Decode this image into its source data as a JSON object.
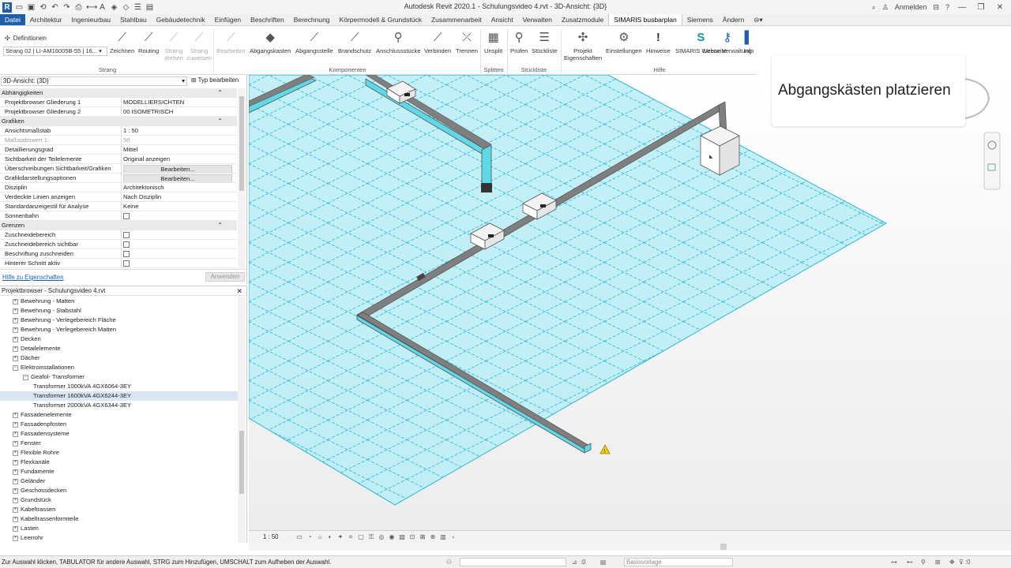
{
  "app": {
    "title": "Autodesk Revit 2020.1 - Schulungsvideo 4.rvt - 3D-Ansicht: {3D}",
    "user": "Anmelden",
    "logo_letter": "R"
  },
  "tabs": [
    "Datei",
    "Architektur",
    "Ingenieurbau",
    "Stahlbau",
    "Gebäudetechnik",
    "Einfügen",
    "Beschriften",
    "Berechnung",
    "Körpermodell & Grundstück",
    "Zusammenarbeit",
    "Ansicht",
    "Verwalten",
    "Zusatzmodule",
    "SIMARIS busbarplan",
    "Siemens",
    "Ändern"
  ],
  "ribbon": {
    "definitionen": "Definitionen",
    "strang_select": "Strang 02 | LI-AM16005B-55 | 16...",
    "buttons": {
      "zeichnen": "Zeichnen",
      "routing": "Routing",
      "strang_drehen": "Strang drehen",
      "strang_zuweisen": "Strang zuweisen",
      "bearbeiten": "Bearbeiten",
      "abgangskasten": "Abgangskasten",
      "abgangsstelle": "Abgangsstelle",
      "brandschutz": "Brandschutz",
      "anschlussstuecke": "Anschlussstücke",
      "verbinden": "Verbinden",
      "trennen": "Trennen",
      "unsplit": "Unsplit",
      "pruefen": "Prüfen",
      "stueckliste": "Stückliste",
      "projekt_eigenschaften": "Projekt Eigenschaften",
      "einstellungen": "Einstellungen",
      "hinweise": "Hinweise",
      "simaris_webseite": "SIMARIS Webseite",
      "lizenz_verwaltung": "Lizenz Verwaltung",
      "info": "Info"
    },
    "groups": {
      "strang": "Strang",
      "komponenten": "Komponenten",
      "splitten": "Splitten",
      "stueckliste": "Stückliste",
      "hilfe": "Hilfe"
    }
  },
  "properties": {
    "view_select": "3D-Ansicht: {3D}",
    "type_button": "Typ bearbeiten",
    "rows": [
      {
        "kind": "section",
        "label": "Abhängigkeiten"
      },
      {
        "label": "Projektbrowser Gliederung 1",
        "value": "MODELLIERSICHTEN"
      },
      {
        "label": "Projektbrowser Gliederung 2",
        "value": "00 ISOMETRISCH"
      },
      {
        "kind": "section",
        "label": "Grafiken"
      },
      {
        "label": "Ansichtsmaßstab",
        "value": "1 : 50"
      },
      {
        "label": "Maßstabswert 1:",
        "value": "50",
        "grey": true
      },
      {
        "label": "Detaillierungsgrad",
        "value": "Mittel"
      },
      {
        "label": "Sichtbarkeit der Teilelemente",
        "value": "Original anzeigen"
      },
      {
        "label": "Überschreibungen Sichtbarkeit/Grafiken",
        "value": "Bearbeiten...",
        "button": true
      },
      {
        "label": "Grafikdarstellungsoptionen",
        "value": "Bearbeiten...",
        "button": true
      },
      {
        "label": "Disziplin",
        "value": "Architektonisch"
      },
      {
        "label": "Verdeckte Linien anzeigen",
        "value": "Nach Disziplin"
      },
      {
        "label": "Standardanzeigestil für Analyse",
        "value": "Keine"
      },
      {
        "label": "Sonnenbahn",
        "value": "",
        "checkbox": true
      },
      {
        "kind": "section",
        "label": "Grenzen"
      },
      {
        "label": "Zuschneidebereich",
        "value": "",
        "checkbox": true
      },
      {
        "label": "Zuschneidebereich sichtbar",
        "value": "",
        "checkbox": true
      },
      {
        "label": "Beschriftung zuschneiden",
        "value": "",
        "checkbox": true
      },
      {
        "label": "Hinterer Schnitt aktiv",
        "value": "",
        "checkbox": true
      }
    ],
    "help_link": "Hilfe zu Eigenschaften",
    "apply": "Anwenden"
  },
  "browser": {
    "title": "Projektbrowser - Schulungsvideo 4.rvt",
    "items": [
      {
        "label": "Bewehrung - Matten",
        "level": 1,
        "toggle": "+"
      },
      {
        "label": "Bewehrung - Stabstahl",
        "level": 1,
        "toggle": "+"
      },
      {
        "label": "Bewehrung - Verlegebereich Fläche",
        "level": 1,
        "toggle": "+"
      },
      {
        "label": "Bewehrung - Verlegebereich Matten",
        "level": 1,
        "toggle": "+"
      },
      {
        "label": "Decken",
        "level": 1,
        "toggle": "+"
      },
      {
        "label": "Detailelemente",
        "level": 1,
        "toggle": "+"
      },
      {
        "label": "Dächer",
        "level": 1,
        "toggle": "+"
      },
      {
        "label": "Elektroinstallationen",
        "level": 1,
        "toggle": "−"
      },
      {
        "label": "Geafol- Transformer",
        "level": 2,
        "toggle": "−"
      },
      {
        "label": "Transformer 1000kVA  4GX6064-3EY",
        "level": 3,
        "toggle": ""
      },
      {
        "label": "Transformer 1600kVA  4GX6244-3EY",
        "level": 3,
        "toggle": "",
        "selected": true
      },
      {
        "label": "Transformer 2000kVA  4GX6344-3EY",
        "level": 3,
        "toggle": ""
      },
      {
        "label": "Fassadenelemente",
        "level": 1,
        "toggle": "+"
      },
      {
        "label": "Fassadenpfosten",
        "level": 1,
        "toggle": "+"
      },
      {
        "label": "Fassadensysteme",
        "level": 1,
        "toggle": "+"
      },
      {
        "label": "Fenster",
        "level": 1,
        "toggle": "+"
      },
      {
        "label": "Flexible Rohre",
        "level": 1,
        "toggle": "+"
      },
      {
        "label": "Flexkanäle",
        "level": 1,
        "toggle": "+"
      },
      {
        "label": "Fundamente",
        "level": 1,
        "toggle": "+"
      },
      {
        "label": "Geländer",
        "level": 1,
        "toggle": "+"
      },
      {
        "label": "Geschossdecken",
        "level": 1,
        "toggle": "+"
      },
      {
        "label": "Grundstück",
        "level": 1,
        "toggle": "+"
      },
      {
        "label": "Kabeltrassen",
        "level": 1,
        "toggle": "+"
      },
      {
        "label": "Kabeltrassenformteile",
        "level": 1,
        "toggle": "+"
      },
      {
        "label": "Lasten",
        "level": 1,
        "toggle": "+"
      },
      {
        "label": "Leerrohr",
        "level": 1,
        "toggle": "+"
      }
    ]
  },
  "callout": "Abgangskästen platzieren",
  "viewbar": {
    "scale": "1 : 50"
  },
  "status": {
    "message": "Zur Auswahl klicken, TABULATOR für andere Auswahl, STRG zum Hinzufügen, UMSCHALT zum Aufheben der Auswahl.",
    "count": ":0",
    "design_option": "Basisvorlage",
    "filter_count": ":0"
  },
  "colors": {
    "accent": "#1f5fa8",
    "busbar_cyan": "#5fd8e8",
    "plane": "#b9ecf4",
    "grid_line": "#2bb7d6"
  }
}
